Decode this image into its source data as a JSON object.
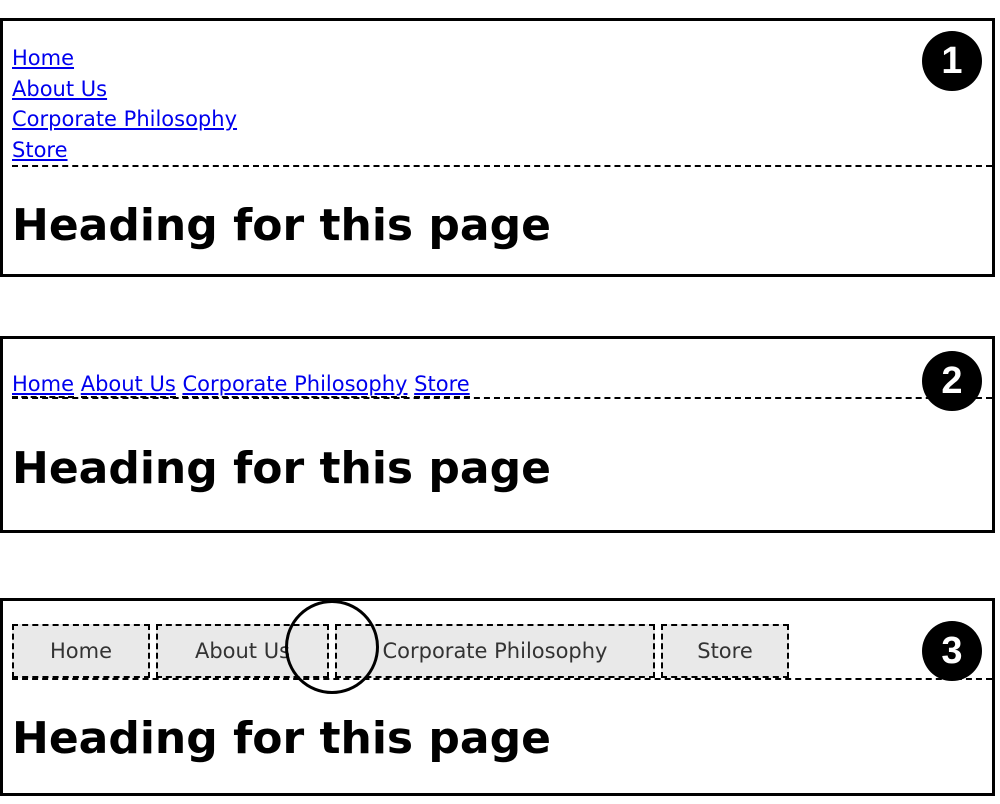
{
  "panels": [
    {
      "number": "1",
      "layout": "block",
      "nav": [
        "Home",
        "About Us",
        "Corporate Philosophy",
        "Store"
      ],
      "heading": "Heading for this page"
    },
    {
      "number": "2",
      "layout": "inline",
      "nav": [
        "Home",
        "About Us",
        "Corporate Philosophy",
        "Store"
      ],
      "heading": "Heading for this page"
    },
    {
      "number": "3",
      "layout": "floated-boxes",
      "nav": [
        "Home",
        "About Us",
        "Corporate Philosophy",
        "Store"
      ],
      "heading": "Heading for this page",
      "callout": "circle highlighting gap between floated boxes"
    }
  ],
  "colors": {
    "link": "#0000ee",
    "tab_background": "#e9e9e9",
    "border": "#000000"
  }
}
